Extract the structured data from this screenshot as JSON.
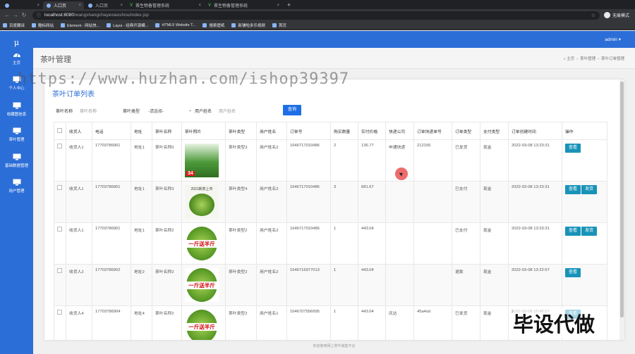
{
  "browser": {
    "tabs": [
      {
        "label": "",
        "active": false
      },
      {
        "label": "入口页",
        "active": true
      },
      {
        "label": "入口页",
        "active": false
      },
      {
        "label": "茶生物备管理系统",
        "active": false,
        "wide": true
      },
      {
        "label": "茶生物备管理系统",
        "active": false,
        "wide": true
      }
    ],
    "new_tab": "+",
    "url_host": "localhost:8080",
    "url_path": "/wangshangchayexiaoshou/index.jsp",
    "profile": "无痕模式",
    "bookmarks": [
      "百度翻译",
      "酷标网站",
      "Element - 网站快...",
      "Layui - 经典开源模...",
      "HTML5 Website T...",
      "搜索壁纸",
      "新铺啦多乐视频",
      "首页"
    ]
  },
  "app": {
    "logo": "μ",
    "sidebar": [
      {
        "label": "主页",
        "icon": "dashboard-icon"
      },
      {
        "label": "个人中心",
        "icon": "monitor-icon"
      },
      {
        "label": "收藏图信息",
        "icon": "monitor-icon"
      },
      {
        "label": "茶叶管理",
        "icon": "monitor-icon"
      },
      {
        "label": "基础数据管理",
        "icon": "monitor-icon"
      },
      {
        "label": "用户管理",
        "icon": "monitor-icon"
      }
    ],
    "user": "admin ▾",
    "page_title": "茶叶管理",
    "breadcrumb": [
      "⌂ 主页",
      "›",
      "茶叶管理",
      "›",
      "茶叶订单管理"
    ]
  },
  "card": {
    "title": "茶叶订单列表",
    "filters": {
      "name_label": "茶叶名称",
      "name_placeholder": "茶叶名称",
      "type_label": "茶叶类型",
      "type_value": "-请选择-",
      "user_label": "用户姓名",
      "user_placeholder": "用户姓名",
      "search": "查询"
    }
  },
  "table": {
    "headers": [
      "",
      "收货人",
      "电话",
      "地址",
      "茶叶名称",
      "茶叶照片",
      "茶叶类型",
      "用户姓名",
      "订单号",
      "购买数量",
      "实付价格",
      "快递公司",
      "订单快递单号",
      "订单类型",
      "支付类型",
      "订单创建时间",
      "操作"
    ],
    "rows": [
      {
        "receiver": "收货人1",
        "phone": "17703786901",
        "address": "地址1",
        "tea": "茶叶名称0",
        "img": "t1",
        "img_text": "34",
        "type": "茶叶类型3",
        "user": "用户姓名2",
        "order_no": "1646717010486",
        "qty": "2",
        "price": "136.77",
        "courier": "申通快递",
        "tracking": "212156",
        "status": "已发货",
        "pay": "现金",
        "time": "2022-03-08 13:23:31",
        "actions": [
          "查看"
        ]
      },
      {
        "receiver": "收货人1",
        "phone": "17703786901",
        "address": "地址1",
        "tea": "茶叶名称3",
        "img": "t2",
        "img_text": "2021新茶上市",
        "type": "茶叶类型4",
        "user": "用户姓名2",
        "order_no": "1646717010486",
        "qty": "3",
        "price": "681.67",
        "courier": "",
        "tracking": "",
        "status": "已支付",
        "pay": "现金",
        "time": "2022-03-08 13:23:31",
        "actions": [
          "查看",
          "发货"
        ]
      },
      {
        "receiver": "收货人1",
        "phone": "17703786901",
        "address": "地址1",
        "tea": "茶叶名称2",
        "img": "t3",
        "img_text": "一斤送半斤",
        "type": "茶叶类型2",
        "user": "用户姓名2",
        "order_no": "1646717010486",
        "qty": "1",
        "price": "443.04",
        "courier": "",
        "tracking": "",
        "status": "已支付",
        "pay": "现金",
        "time": "2022-03-08 13:23:31",
        "actions": [
          "查看",
          "发货"
        ]
      },
      {
        "receiver": "收货人2",
        "phone": "17703786902",
        "address": "地址2",
        "tea": "茶叶名称2",
        "img": "t3",
        "img_text": "一斤送半斤",
        "type": "茶叶类型2",
        "user": "用户姓名2",
        "order_no": "1646716977013",
        "qty": "1",
        "price": "443.04",
        "courier": "",
        "tracking": "",
        "status": "退款",
        "pay": "现金",
        "time": "2022-03-08 13:22:57",
        "actions": [
          "查看"
        ]
      },
      {
        "receiver": "收货人4",
        "phone": "17703786904",
        "address": "地址4",
        "tea": "茶叶名称2",
        "img": "t3",
        "img_text": "一斤送半斤",
        "type": "茶叶类型2",
        "user": "用户姓名1",
        "order_no": "1646707556995",
        "qty": "1",
        "price": "443.04",
        "courier": "庆达",
        "tracking": "45a4sd",
        "status": "已发货",
        "pay": "现金",
        "time": "2022-03-08 10:45:57",
        "actions": [
          "查看"
        ]
      }
    ]
  },
  "footer": "欢迎使用网上茶叶销售平台",
  "watermark": "https://www.huzhan.com/ishop39397",
  "corner_mark": "毕设代做"
}
